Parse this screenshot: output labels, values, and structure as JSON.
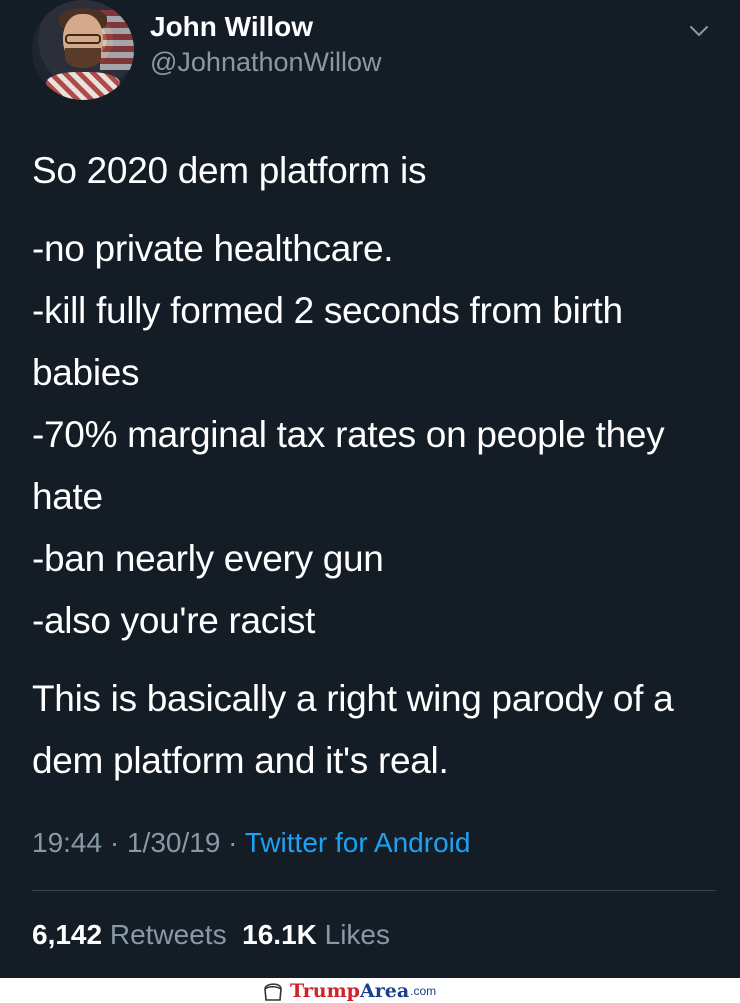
{
  "tweet": {
    "author_name": "John Willow",
    "author_handle": "@JohnathonWillow",
    "intro": "So 2020 dem platform is",
    "list_lines": [
      "-no private healthcare.",
      "-kill fully formed 2 seconds from birth babies",
      "-70% marginal tax rates on people they hate",
      "-ban nearly every gun",
      "-also you're racist"
    ],
    "closing": "This is basically a right wing parody of a dem platform and it's real.",
    "time": "19:44",
    "date": "1/30/19",
    "separator": "·",
    "source": "Twitter for Android",
    "retweets_count": "6,142",
    "retweets_label": "Retweets",
    "likes_count": "16.1K",
    "likes_label": "Likes"
  },
  "watermark": {
    "brand_part1": "Trump",
    "brand_part2": "Area",
    "brand_suffix": ".com"
  },
  "colors": {
    "background": "#141d26",
    "text": "#ffffff",
    "muted": "#8899a6",
    "link": "#1da1f2"
  },
  "icons": {
    "menu": "chevron-down-icon",
    "watermark": "trump-hair-icon"
  }
}
